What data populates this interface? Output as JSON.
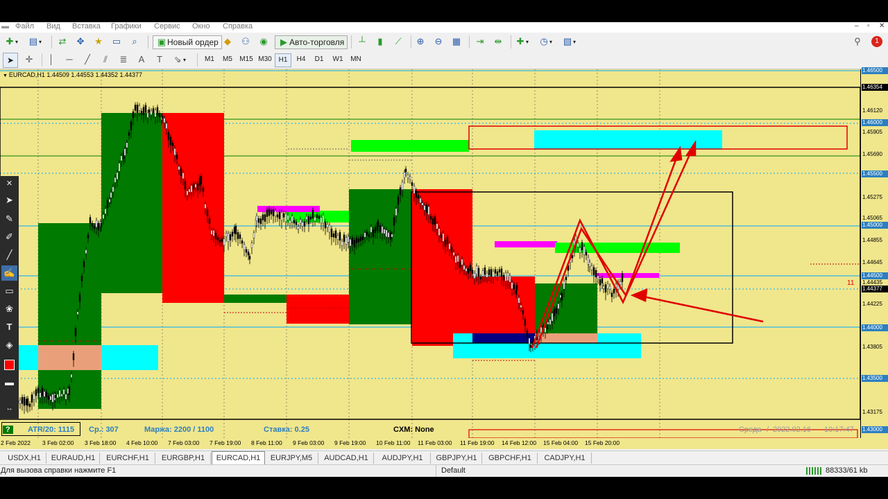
{
  "menu": [
    "Файл",
    "Вид",
    "Вставка",
    "Графики",
    "Сервис",
    "Окно",
    "Справка"
  ],
  "toolbar": {
    "new_order": "Новый ордер",
    "auto_trading": "Авто-торговля"
  },
  "timeframes": [
    "M1",
    "M5",
    "M15",
    "M30",
    "H1",
    "H4",
    "D1",
    "W1",
    "MN"
  ],
  "active_timeframe": "H1",
  "chart": {
    "header": "EURCAD,H1  1.44509 1.44553 1.44352 1.44377",
    "info": {
      "atr": "ATR/20: 1115",
      "avg": "Ср.: 307",
      "margin": "Маржа: 2200 / 1100",
      "rate": "Ставка: 0.25",
      "cxm": "CXM: None",
      "weekday": "Среда",
      "datetime": "2022.02.16",
      "time": "10:17:47",
      "marker_num": "11",
      "question": "?"
    },
    "price_labels": [
      "1.46500",
      "1.46354",
      "1.46120",
      "1.46000",
      "1.45905",
      "1.45690",
      "1.45500",
      "1.45275",
      "1.45065",
      "1.45000",
      "1.44855",
      "1.44645",
      "1.44500",
      "1.44435",
      "1.44377",
      "1.44225",
      "1.44000",
      "1.43805",
      "1.43500",
      "1.43175",
      "1.43000"
    ],
    "price_tags": {
      "p1": "1.46500",
      "p2": "1.46354",
      "p3": "1.46000",
      "p4": "1.45500",
      "p5": "1.45000",
      "p6": "1.44500",
      "p7": "1.44377",
      "p8": "1.44000",
      "p9": "1.43500",
      "p10": "1.43000"
    },
    "time_labels": [
      "2 Feb 2022",
      "3 Feb 02:00",
      "3 Feb 18:00",
      "4 Feb 10:00",
      "7 Feb 03:00",
      "7 Feb 19:00",
      "8 Feb 11:00",
      "9 Feb 03:00",
      "9 Feb 19:00",
      "10 Feb 11:00",
      "11 Feb 03:00",
      "11 Feb 19:00",
      "14 Feb 12:00",
      "15 Feb 04:00",
      "15 Feb 20:00"
    ],
    "colors": {
      "bg": "#f0e68c",
      "bull": "#007a00",
      "bear": "#ff0000",
      "cyan": "#00ffff",
      "green": "#00ff00",
      "magenta": "#ff00ff",
      "salmon": "#e9a07a",
      "navy": "#000080"
    }
  },
  "tabs": [
    "USDX,H1",
    "EURAUD,H1",
    "EURCHF,H1",
    "EURGBP,H1",
    "EURCAD,H1",
    "EURJPY,M5",
    "AUDCAD,H1",
    "AUDJPY,H1",
    "GBPJPY,H1",
    "GBPCHF,H1",
    "CADJPY,H1"
  ],
  "active_tab": "EURCAD,H1",
  "status": {
    "help": "Для вызова справки нажмите F1",
    "profile": "Default",
    "traffic": "88333/61 kb"
  },
  "notification_count": "1"
}
